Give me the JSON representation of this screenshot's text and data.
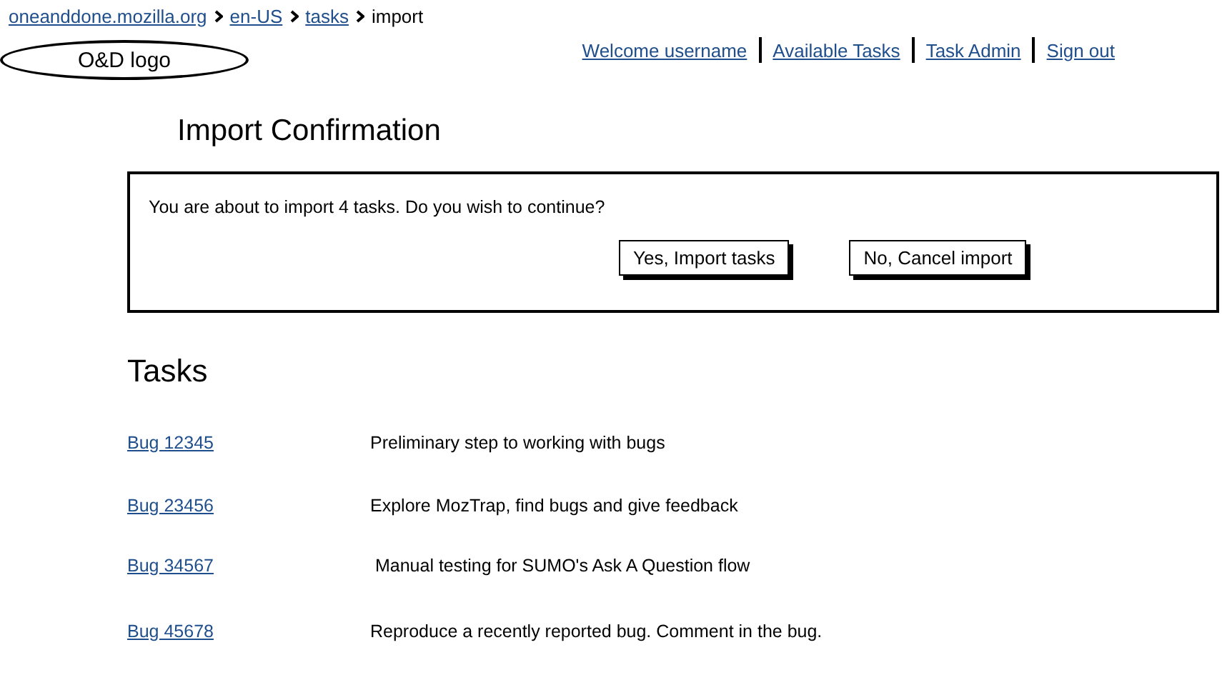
{
  "breadcrumb": {
    "links": [
      "oneanddone.mozilla.org",
      "en-US",
      "tasks"
    ],
    "current": "import"
  },
  "nav": [
    "Welcome username",
    "Available Tasks",
    "Task Admin",
    "Sign out"
  ],
  "logo": "O&D logo",
  "title": "Import Confirmation",
  "dialog": {
    "message": "You are about to import 4 tasks. Do you wish to continue?",
    "buttons": [
      "Yes, Import tasks",
      "No, Cancel import"
    ]
  },
  "tasks_heading": "Tasks",
  "tasks": [
    {
      "bug": "Bug 12345",
      "description": "Preliminary step to working with bugs"
    },
    {
      "bug": "Bug 23456",
      "description": "Explore MozTrap, find bugs and give feedback"
    },
    {
      "bug": "Bug 34567",
      "description": " Manual testing for SUMO's Ask A Question flow"
    },
    {
      "bug": "Bug 45678",
      "description": "Reproduce a recently reported bug. Comment in the bug."
    }
  ]
}
